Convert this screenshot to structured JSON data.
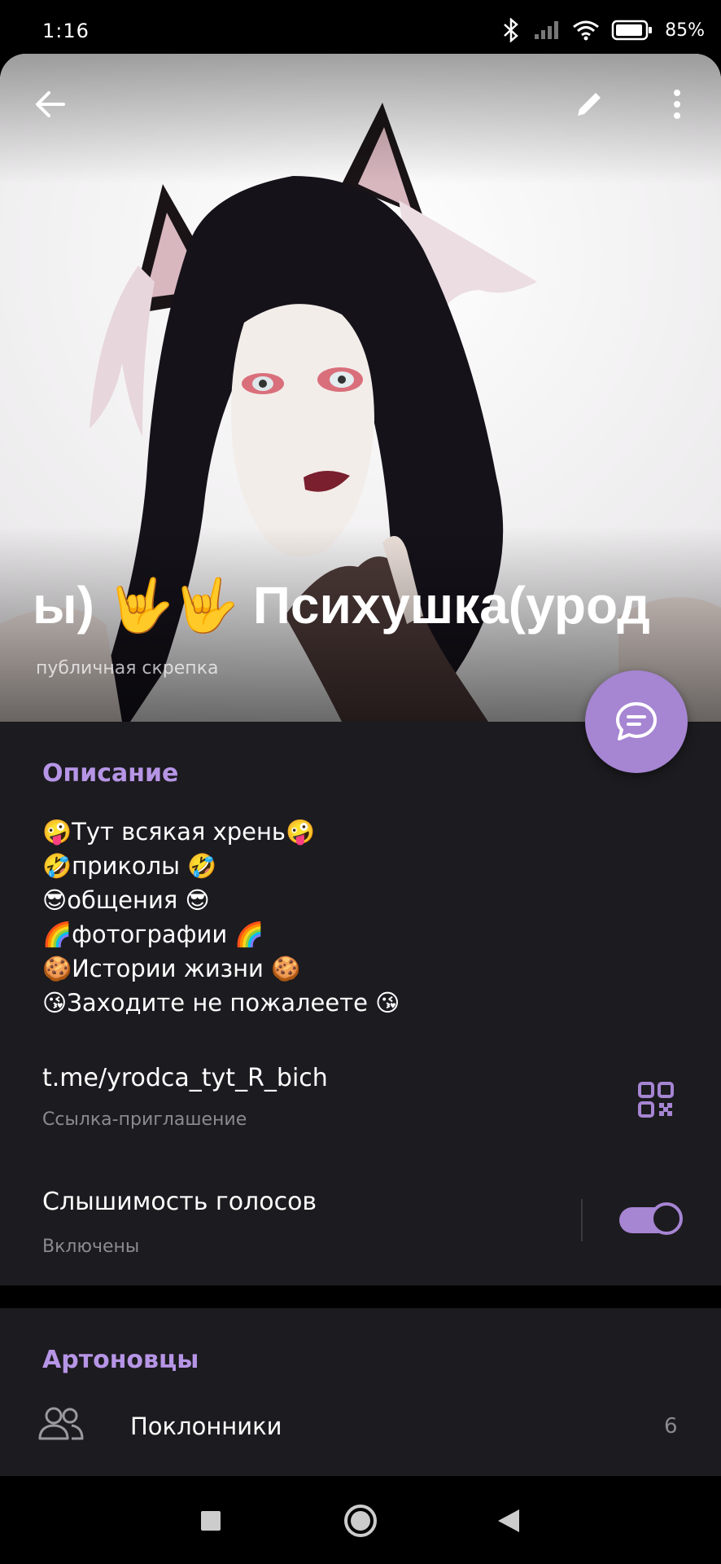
{
  "status": {
    "time": "1:16",
    "battery": "85%"
  },
  "header": {
    "title": "ы) 🤟🤟    Психушка(урод",
    "subtitle": "публичная скрепка"
  },
  "description": {
    "heading": "Описание",
    "lines": [
      "🤪Тут всякая хрень🤪",
      "🤣приколы 🤣",
      "😎общения 😎",
      "🌈фотографии 🌈",
      "🍪Истории жизни 🍪",
      "😘Заходите не пожалеете 😘"
    ]
  },
  "invite": {
    "link": "t.me/yrodca_tyt_R_bich",
    "label": "Ссылка-приглашение"
  },
  "voices": {
    "label": "Слышимость голосов",
    "status": "Включены",
    "enabled": true
  },
  "members": {
    "heading": "Артоновцы",
    "label": "Поклонники",
    "count": "6"
  },
  "colors": {
    "accent": "#a685d3",
    "card": "#1c1b1f"
  },
  "icons": [
    "back-arrow-icon",
    "edit-pencil-icon",
    "more-vert-icon",
    "chat-bubble-icon",
    "qr-code-icon",
    "people-icon",
    "nav-square-icon",
    "nav-circle-icon",
    "nav-triangle-icon"
  ]
}
